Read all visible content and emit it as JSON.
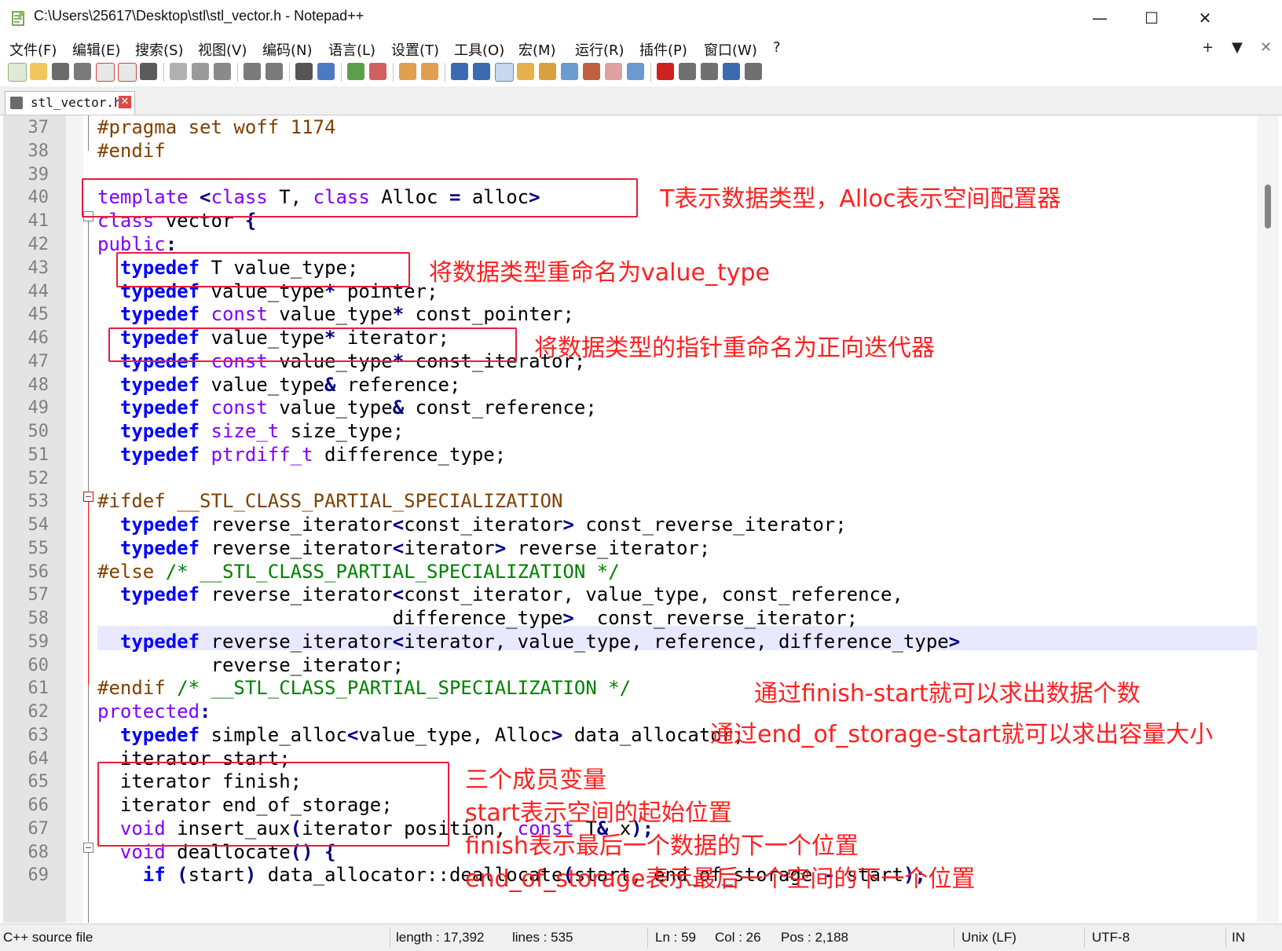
{
  "window": {
    "title": "C:\\Users\\25617\\Desktop\\stl\\stl_vector.h - Notepad++",
    "controls": {
      "minimize": "—",
      "maximize": "☐",
      "close": "✕"
    }
  },
  "menu": {
    "items": [
      "文件(F)",
      "编辑(E)",
      "搜索(S)",
      "视图(V)",
      "编码(N)",
      "语言(L)",
      "设置(T)",
      "工具(O)",
      "宏(M)",
      "运行(R)",
      "插件(P)",
      "窗口(W)",
      "?"
    ],
    "right": {
      "plus": "+",
      "dropdown": "▼",
      "close": "✕"
    }
  },
  "tab": {
    "label": "stl_vector.h",
    "close": "✕"
  },
  "editor": {
    "line_numbers": [
      "37",
      "38",
      "39",
      "40",
      "41",
      "42",
      "43",
      "44",
      "45",
      "46",
      "47",
      "48",
      "49",
      "50",
      "51",
      "52",
      "53",
      "54",
      "55",
      "56",
      "57",
      "58",
      "59",
      "60",
      "61",
      "62",
      "63",
      "64",
      "65",
      "66",
      "67",
      "68",
      "69"
    ],
    "current_line": "59"
  },
  "annotations": {
    "a1": "T表示数据类型，Alloc表示空间配置器",
    "a2": "将数据类型重命名为value_type",
    "a3": "将数据类型的指针重命名为正向迭代器",
    "a4": "通过finish-start就可以求出数据个数",
    "a5": "通过end_of_storage-start就可以求出容量大小",
    "a6": "三个成员变量",
    "a7": "start表示空间的起始位置",
    "a8": "finish表示最后一个数据的下一个位置",
    "a9": "end_of_storage表示最后一个空间的下一个位置"
  },
  "status": {
    "filetype": "C++ source file",
    "length": "length : 17,392",
    "lines": "lines : 535",
    "ln": "Ln : 59",
    "col": "Col : 26",
    "pos": "Pos : 2,188",
    "eol": "Unix (LF)",
    "encoding": "UTF-8",
    "mode": "IN"
  },
  "colors": {
    "keyword": "#8000ff",
    "type_keyword": "#0000ff",
    "preprocessor": "#804000",
    "comment": "#008000",
    "annotation": "#ff2020"
  }
}
